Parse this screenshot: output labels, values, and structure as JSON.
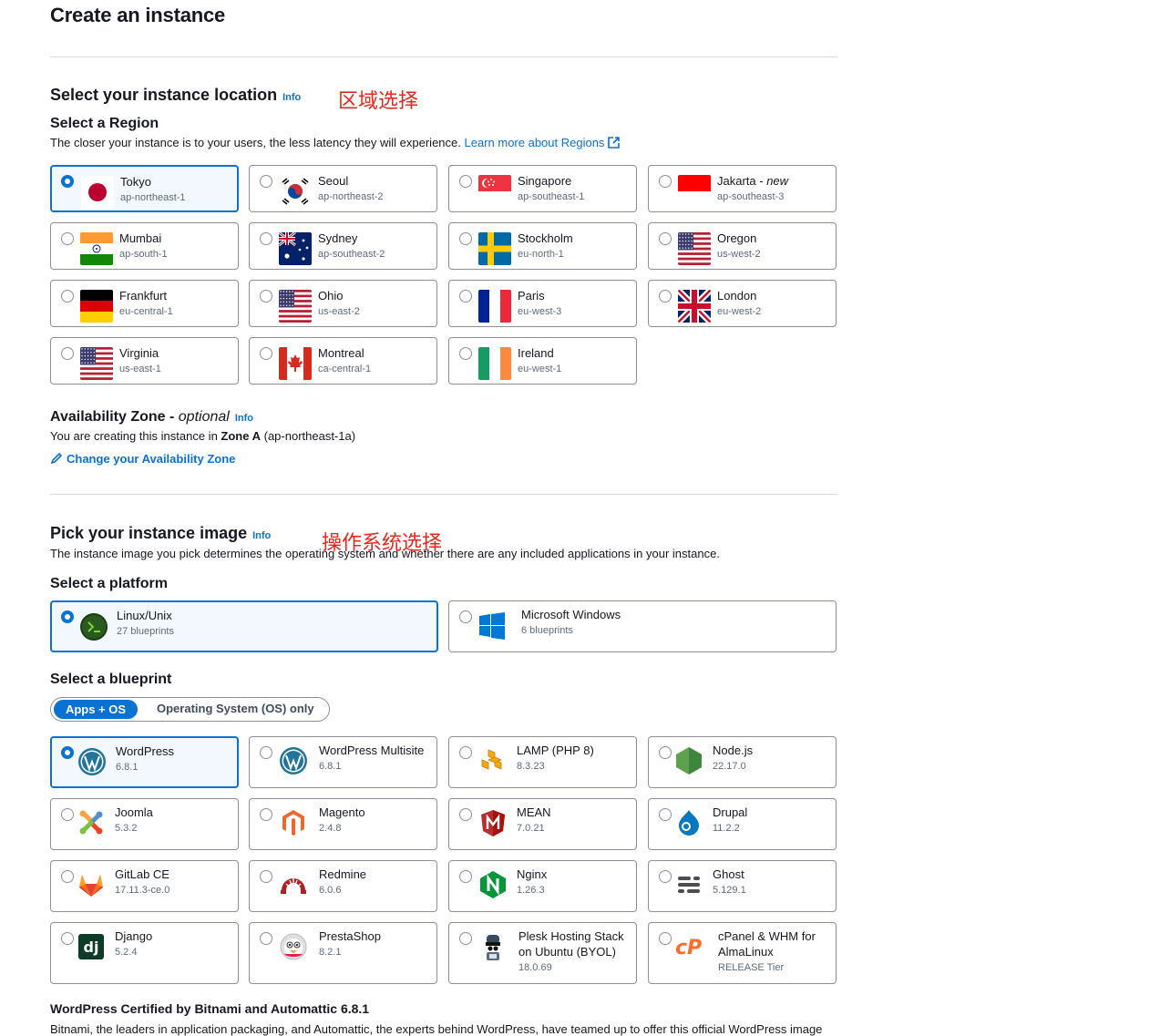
{
  "page_title": "Create an instance",
  "location": {
    "title": "Select your instance location",
    "info": "Info",
    "annotation": "区域选择",
    "region_heading": "Select a Region",
    "region_desc": "The closer your instance is to your users, the less latency they will experience.",
    "learn_more": "Learn more about Regions",
    "regions": [
      {
        "name": "Tokyo",
        "code": "ap-northeast-1",
        "flag": "japan-flag",
        "selected": true
      },
      {
        "name": "Seoul",
        "code": "ap-northeast-2",
        "flag": "korea-flag"
      },
      {
        "name": "Singapore",
        "code": "ap-southeast-1",
        "flag": "singapore-flag"
      },
      {
        "name": "Jakarta - ",
        "name_em": "new",
        "code": "ap-southeast-3",
        "flag": "indonesia-flag"
      },
      {
        "name": "Mumbai",
        "code": "ap-south-1",
        "flag": "india-flag"
      },
      {
        "name": "Sydney",
        "code": "ap-southeast-2",
        "flag": "australia-flag"
      },
      {
        "name": "Stockholm",
        "code": "eu-north-1",
        "flag": "sweden-flag"
      },
      {
        "name": "Oregon",
        "code": "us-west-2",
        "flag": "usa-flag"
      },
      {
        "name": "Frankfurt",
        "code": "eu-central-1",
        "flag": "germany-flag"
      },
      {
        "name": "Ohio",
        "code": "us-east-2",
        "flag": "usa-flag"
      },
      {
        "name": "Paris",
        "code": "eu-west-3",
        "flag": "france-flag"
      },
      {
        "name": "London",
        "code": "eu-west-2",
        "flag": "uk-flag"
      },
      {
        "name": "Virginia",
        "code": "us-east-1",
        "flag": "usa-flag"
      },
      {
        "name": "Montreal",
        "code": "ca-central-1",
        "flag": "canada-flag"
      },
      {
        "name": "Ireland",
        "code": "eu-west-1",
        "flag": "ireland-flag"
      }
    ],
    "az_heading": "Availability Zone - ",
    "az_optional": "optional",
    "az_desc_prefix": "You are creating this instance in ",
    "az_zone": "Zone A",
    "az_desc_suffix": " (ap-northeast-1a)",
    "az_change": "Change your Availability Zone"
  },
  "image": {
    "title": "Pick your instance image",
    "info": "Info",
    "annotation": "操作系统选择",
    "desc": "The instance image you pick determines the operating system and whether there are any included applications in your instance.",
    "platform_heading": "Select a platform",
    "platforms": [
      {
        "name": "Linux/Unix",
        "sub": "27 blueprints",
        "icon": "terminal-icon",
        "selected": true
      },
      {
        "name": "Microsoft Windows",
        "sub": "6 blueprints",
        "icon": "windows-icon"
      }
    ],
    "blueprint_heading": "Select a blueprint",
    "tabs": [
      "Apps + OS",
      "Operating System (OS) only"
    ],
    "blueprints": [
      {
        "name": "WordPress",
        "sub": "6.8.1",
        "icon": "wordpress-icon",
        "selected": true
      },
      {
        "name": "WordPress Multisite",
        "sub": "6.8.1",
        "icon": "wordpress-icon"
      },
      {
        "name": "LAMP (PHP 8)",
        "sub": "8.3.23",
        "icon": "lamp-icon"
      },
      {
        "name": "Node.js",
        "sub": "22.17.0",
        "icon": "nodejs-icon"
      },
      {
        "name": "Joomla",
        "sub": "5.3.2",
        "icon": "joomla-icon"
      },
      {
        "name": "Magento",
        "sub": "2.4.8",
        "icon": "magento-icon"
      },
      {
        "name": "MEAN",
        "sub": "7.0.21",
        "icon": "mean-icon"
      },
      {
        "name": "Drupal",
        "sub": "11.2.2",
        "icon": "drupal-icon"
      },
      {
        "name": "GitLab CE",
        "sub": "17.11.3-ce.0",
        "icon": "gitlab-icon"
      },
      {
        "name": "Redmine",
        "sub": "6.0.6",
        "icon": "redmine-icon"
      },
      {
        "name": "Nginx",
        "sub": "1.26.3",
        "icon": "nginx-icon"
      },
      {
        "name": "Ghost",
        "sub": "5.129.1",
        "icon": "ghost-icon"
      },
      {
        "name": "Django",
        "sub": "5.2.4",
        "icon": "django-icon"
      },
      {
        "name": "PrestaShop",
        "sub": "8.2.1",
        "icon": "prestashop-icon"
      },
      {
        "name": "Plesk Hosting Stack",
        "name2": "on Ubuntu (BYOL)",
        "sub": "18.0.69",
        "icon": "plesk-icon"
      },
      {
        "name": "cPanel & WHM for",
        "name2": "AlmaLinux",
        "sub": "RELEASE Tier",
        "icon": "cpanel-icon"
      }
    ],
    "certified_title": "WordPress Certified by Bitnami and Automattic 6.8.1",
    "certified_desc": "Bitnami, the leaders in application packaging, and Automattic, the experts behind WordPress, have teamed up to offer this official WordPress image"
  },
  "colors": {
    "accent": "#0972d3",
    "annotation": "#e8281e",
    "border": "#8d9096"
  }
}
